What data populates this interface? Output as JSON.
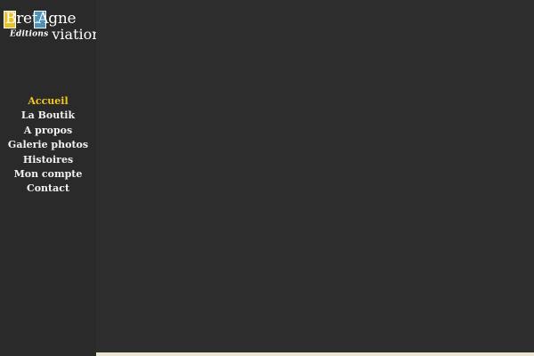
{
  "logo": {
    "line1": "BretAgne",
    "editions": "Editions",
    "aviation": "viation"
  },
  "nav": {
    "items": [
      {
        "label": "Accueil",
        "active": true
      },
      {
        "label": "La Boutik",
        "active": false
      },
      {
        "label": "A propos",
        "active": false
      },
      {
        "label": "Galerie photos",
        "active": false
      },
      {
        "label": "Histoires",
        "active": false
      },
      {
        "label": "Mon compte",
        "active": false
      },
      {
        "label": "Contact",
        "active": false
      }
    ]
  },
  "colors": {
    "background": "#2e2e2e",
    "sidebar": "#2a2a2a",
    "accent": "#f4c620",
    "logo_yellow": "#e9c229",
    "logo_blue": "#4b93b8",
    "nav_text": "#f2f2f2",
    "bottom_strip": "#ece4d3"
  }
}
